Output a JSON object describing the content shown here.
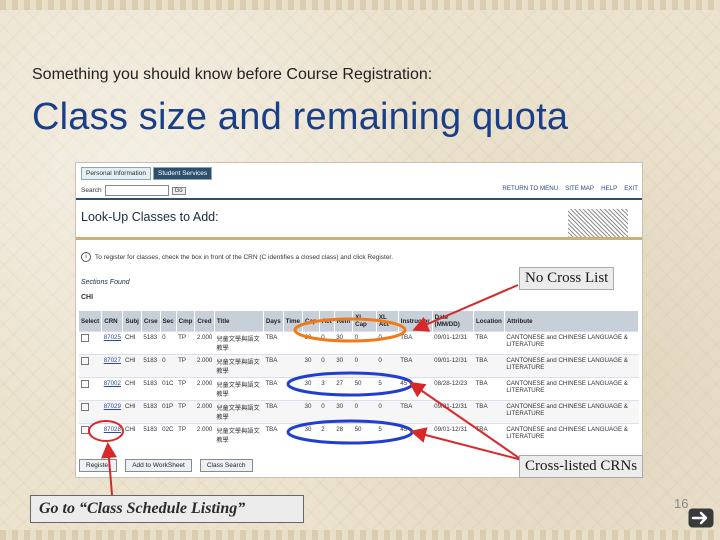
{
  "slide": {
    "subtitle": "Something you should know before Course Registration:",
    "title": "Class size and remaining quota",
    "page_number": "16"
  },
  "screenshot": {
    "tabs": [
      "Personal Information",
      "Student Services"
    ],
    "search_label": "Search",
    "go_label": "Go",
    "topnav": [
      "RETURN TO MENU",
      "SITE MAP",
      "HELP",
      "EXIT"
    ],
    "page_title": "Look-Up Classes to Add:",
    "info_text": "To register for classes, check the box in front of the CRN (C identifies a closed class) and click Register.",
    "sections_found": "Sections Found",
    "subject": "CHI",
    "columns": [
      "Select",
      "CRN",
      "Subj",
      "Crse",
      "Sec",
      "Cmp",
      "Cred",
      "Title",
      "Days",
      "Time",
      "Cap",
      "Act",
      "Rem",
      "XL Cap",
      "XL Act",
      "Instructor",
      "Date (MM/DD)",
      "Location",
      "Attribute"
    ],
    "rows": [
      [
        "",
        "87025",
        "CHI",
        "5183",
        "0",
        "TP",
        "2.000",
        "兒童文學與語文教學",
        "TBA",
        "",
        "30",
        "0",
        "30",
        "0",
        "0",
        "TBA",
        "09/01-12/31",
        "TBA",
        "CANTONESE and CHINESE LANGUAGE & LITERATURE"
      ],
      [
        "",
        "87027",
        "CHI",
        "5183",
        "0",
        "TP",
        "2.000",
        "兒童文學與語文教學",
        "TBA",
        "",
        "30",
        "0",
        "30",
        "0",
        "0",
        "TBA",
        "09/01-12/31",
        "TBA",
        "CANTONESE and CHINESE LANGUAGE & LITERATURE"
      ],
      [
        "",
        "87002",
        "CHI",
        "5183",
        "01C",
        "TP",
        "2.000",
        "兒童文學與語文教學",
        "TBA",
        "",
        "30",
        "3",
        "27",
        "50",
        "5",
        "45",
        "08/28-12/23",
        "TBA",
        "CANTONESE and CHINESE LANGUAGE & LITERATURE"
      ],
      [
        "",
        "87029",
        "CHI",
        "5183",
        "01P",
        "TP",
        "2.000",
        "兒童文學與語文教學",
        "TBA",
        "",
        "30",
        "0",
        "30",
        "0",
        "0",
        "TBA",
        "09/01-12/31",
        "TBA",
        "CANTONESE and CHINESE LANGUAGE & LITERATURE"
      ],
      [
        "",
        "87028",
        "CHI",
        "5183",
        "02C",
        "TP",
        "2.000",
        "兒童文學與語文教學",
        "TBA",
        "",
        "30",
        "2",
        "28",
        "50",
        "5",
        "45",
        "09/01-12/31",
        "TBA",
        "CANTONESE and CHINESE LANGUAGE & LITERATURE"
      ]
    ],
    "buttons": [
      "Register",
      "Add to WorkSheet",
      "Class Search"
    ]
  },
  "callouts": {
    "no_cross": "No Cross List",
    "cross_listed": "Cross-listed CRNs",
    "go_to": "Go to “Class Schedule Listing”"
  },
  "colors": {
    "title_blue": "#1a3f8a",
    "orange_ellipse": "#f07a1a",
    "blue_ellipse": "#1f3fd0",
    "arrow_red": "#d8282a"
  },
  "icons": {
    "next": "next-arrow-icon",
    "info": "info-icon"
  }
}
